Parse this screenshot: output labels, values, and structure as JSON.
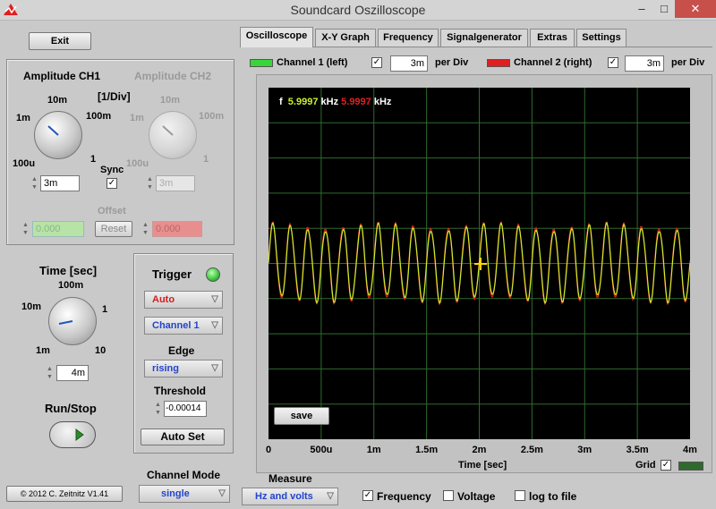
{
  "window": {
    "title": "Soundcard Oszilloscope",
    "minimize": "–",
    "maximize": "□",
    "close": "✕"
  },
  "left": {
    "exit_label": "Exit",
    "amp_ch1": "Amplitude CH1",
    "amp_ch2": "Amplitude CH2",
    "per_div": "[1/Div]",
    "ch1_scale": {
      "s10m": "10m",
      "s100m": "100m",
      "s1m": "1m",
      "s1": "1",
      "s100u": "100u"
    },
    "ch2_scale": {
      "s10m": "10m",
      "s100m": "100m",
      "s1m": "1m",
      "s1": "1",
      "s100u": "100u"
    },
    "ch1_value": "3m",
    "ch2_value": "3m",
    "sync_label": "Sync",
    "offset_label": "Offset",
    "offset_ch1": "0.000",
    "offset_ch2": "0.000",
    "reset_label": "Reset",
    "time_label": "Time [sec]",
    "time_scale": {
      "s100m": "100m",
      "s10m": "10m",
      "s1": "1",
      "s1m": "1m",
      "s10": "10"
    },
    "time_value": "4m",
    "runstop_label": "Run/Stop",
    "copyright": "© 2012  C. Zeitnitz V1.41"
  },
  "trigger": {
    "title": "Trigger",
    "mode": "Auto",
    "channel": "Channel 1",
    "edge_label": "Edge",
    "edge": "rising",
    "threshold_label": "Threshold",
    "threshold": "-0.00014",
    "autoset_label": "Auto Set",
    "led_color": "#3ec43e"
  },
  "channel_mode": {
    "label": "Channel Mode",
    "value": "single"
  },
  "tabs": [
    "Oscilloscope",
    "X-Y Graph",
    "Frequency",
    "Signalgenerator",
    "Extras",
    "Settings"
  ],
  "channels": {
    "ch1_label": "Channel 1 (left)",
    "ch1_value": "3m",
    "ch2_label": "Channel 2 (right)",
    "ch2_value": "3m",
    "per_div": "per Div",
    "ch1_color": "#39d639",
    "ch2_color": "#e02020"
  },
  "scope": {
    "freq_label": "f",
    "freq_ch1": "5.9997",
    "freq_ch2": "5.9997",
    "unit": "kHz",
    "save_label": "save",
    "x_ticks": [
      "0",
      "500u",
      "1m",
      "1.5m",
      "2m",
      "2.5m",
      "3m",
      "3.5m",
      "4m"
    ],
    "xlabel": "Time [sec]",
    "grid_label": "Grid",
    "trace_ch1_color": "#c8f02a",
    "trace_ch2_color": "#e02020",
    "grid_color": "#2f6a2f"
  },
  "measure": {
    "label": "Measure",
    "mode": "Hz and volts",
    "frequency": "Frequency",
    "voltage": "Voltage",
    "log": "log to file"
  }
}
